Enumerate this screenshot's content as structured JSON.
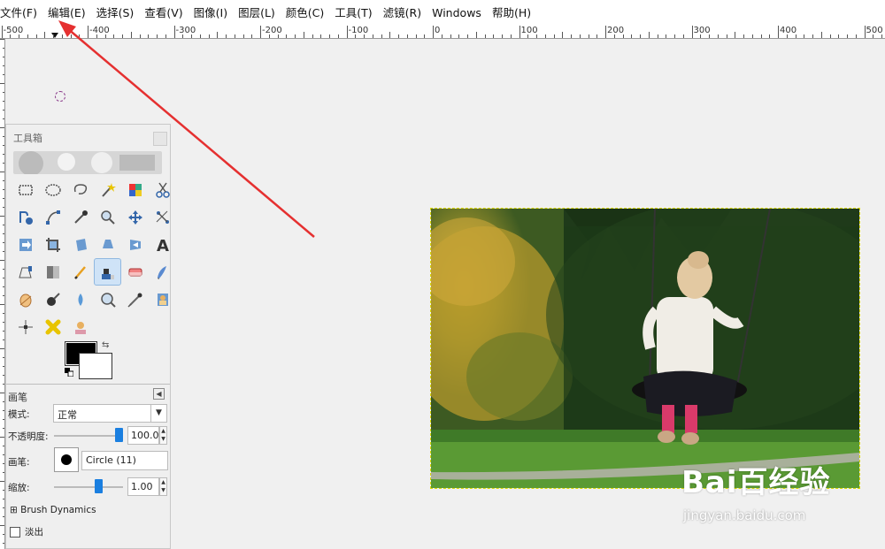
{
  "menubar": {
    "items": [
      "文件(F)",
      "编辑(E)",
      "选择(S)",
      "查看(V)",
      "图像(I)",
      "图层(L)",
      "颜色(C)",
      "工具(T)",
      "滤镜(R)",
      "Windows",
      "帮助(H)"
    ]
  },
  "ruler": {
    "labels": [
      "-500",
      "-400",
      "-300",
      "-200",
      "-100",
      "0",
      "100",
      "200",
      "300",
      "400",
      "500"
    ]
  },
  "toolbox": {
    "title": "工具箱",
    "tools": [
      "rect-select-icon",
      "ellipse-select-icon",
      "free-select-icon",
      "fuzzy-select-icon",
      "color-select-icon",
      "scissors-icon",
      "foreground-select-icon",
      "paths-icon",
      "color-picker-icon",
      "zoom-icon",
      "measure-icon",
      "move-icon",
      "align-icon",
      "crop-icon",
      "rotate-icon",
      "scale-icon",
      "shear-icon",
      "perspective-icon",
      "flip-icon",
      "cage-icon",
      "text-icon",
      "bucket-fill-icon",
      "blend-icon",
      "pencil-icon",
      "paintbrush-icon",
      "eraser-icon",
      "airbrush-icon",
      "ink-icon",
      "clone-icon",
      "heal-icon",
      "smudge-icon",
      "dodge-burn-icon",
      "magnify-icon",
      "unified-transform-icon",
      "warp-icon",
      "stamp-icon"
    ],
    "active_tool": "paintbrush-icon",
    "fg_color": "#000000",
    "bg_color": "#ffffff"
  },
  "tool_options": {
    "title": "画笔",
    "mode_label": "模式:",
    "mode_value": "正常",
    "opacity_label": "不透明度:",
    "opacity_value": "100.0",
    "opacity_fraction": 1.0,
    "brush_label": "画笔:",
    "brush_name": "Circle (11)",
    "scale_label": "缩放:",
    "scale_value": "1.00",
    "dynamics_label": "Brush Dynamics",
    "fade_label": "淡出"
  },
  "watermark": {
    "logo": "Bai百经验",
    "url": "jingyan.baidu.com"
  },
  "colors": {
    "selection_border": "#d8d800",
    "annotation_arrow": "#e53030",
    "active_slider": "#1a7fe0"
  }
}
